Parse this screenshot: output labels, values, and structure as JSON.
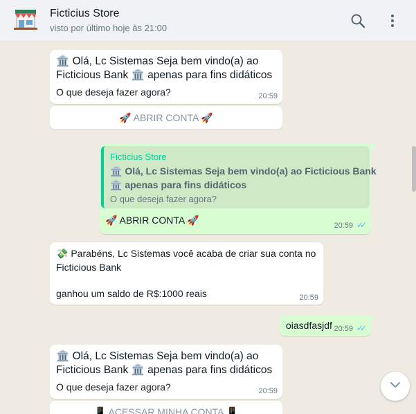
{
  "header": {
    "title": "Ficticius Store",
    "subtitle": "visto por último hoje às 21:00",
    "icons": [
      "store-avatar-icon",
      "search-icon",
      "more-vert-icon"
    ]
  },
  "messages": [
    {
      "from": "in",
      "line1": "🏛️ Olá, Lc Sistemas Seja bem vindo(a) ao",
      "line2": "Ficticious Bank 🏛️ apenas para fins didáticos",
      "line3": "O que deseja fazer agora?",
      "time": "20:59",
      "button": "🚀 ABRIR CONTA 🚀"
    },
    {
      "from": "out",
      "quote_author": "Ficticius Store",
      "quote_line1": "🏛️ Olá, Lc Sistemas Seja bem vindo(a) ao Ficticious Bank",
      "quote_line2": "🏛️ apenas para fins didáticos",
      "quote_line3": "O que deseja fazer agora?",
      "text": "🚀 ABRIR CONTA 🚀",
      "time": "20:59"
    },
    {
      "from": "in",
      "line1": "💸 Parabéns, Lc Sistemas você acaba de criar sua conta no",
      "line2": "Ficticious Bank",
      "line3": "ganhou um saldo de R$:1000 reais",
      "time": "20:59"
    },
    {
      "from": "out",
      "text": "oiasdfasjdf",
      "time": "20:59"
    },
    {
      "from": "in",
      "line1": "🏛️ Olá, Lc Sistemas Seja bem vindo(a) ao",
      "line2": "Ficticious Bank 🏛️ apenas para fins didáticos",
      "line3": "O que deseja fazer agora?",
      "time": "20:59",
      "button": "📱 ACESSAR MINHA CONTA 📱"
    }
  ],
  "colors": {
    "chat_bg": "#efeae2",
    "incoming": "#ffffff",
    "outgoing": "#d9fdd3",
    "read_ticks": "#53bdeb",
    "quote_accent": "#06cf9c"
  }
}
